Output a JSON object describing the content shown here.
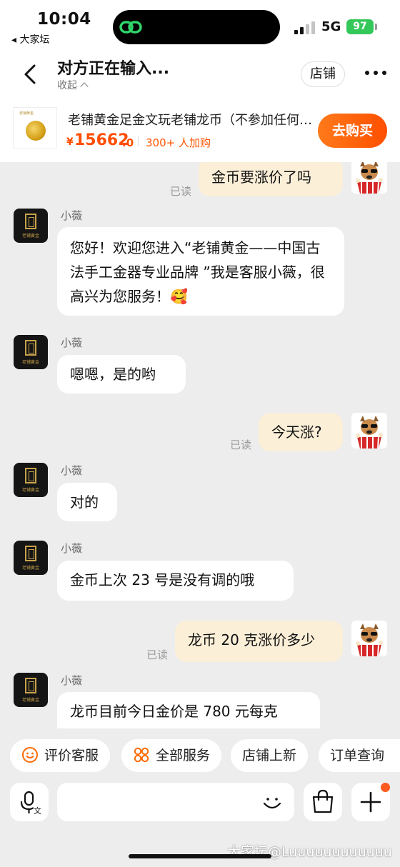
{
  "status_bar": {
    "time": "10:04",
    "back_app": "◂ 大家坛",
    "network": "5G",
    "battery": "97"
  },
  "header": {
    "title": "对方正在输入...",
    "collapse_label": "收起",
    "shop_button": "店铺"
  },
  "product": {
    "image_tag": "老铺黄金",
    "title": "老铺黄金足金文玩老铺龙币（不参加任何活动）",
    "price_symbol": "¥",
    "price_int": "15662",
    "price_dec": ".0",
    "buyers": "300+ 人加购",
    "buy_button": "去购买"
  },
  "chat": {
    "messages": [
      {
        "from": "self",
        "text": "金币要涨价了吗",
        "read": "已读"
      },
      {
        "from": "shop",
        "name": "小薇",
        "text": "您好！欢迎您进入“老铺黄金——中国古法手工金器专业品牌 ”我是客服小薇，很高兴为您服务！🥰"
      },
      {
        "from": "shop",
        "name": "小薇",
        "text": "嗯嗯，是的哟"
      },
      {
        "from": "self",
        "text": "今天涨?",
        "read": "已读"
      },
      {
        "from": "shop",
        "name": "小薇",
        "text": "对的"
      },
      {
        "from": "shop",
        "name": "小薇",
        "text": "金币上次 23 号是没有调的哦"
      },
      {
        "from": "self",
        "text": "龙币 20 克涨价多少",
        "read": "已读"
      },
      {
        "from": "shop",
        "name": "小薇",
        "text": "龙币目前今日金价是 780 元每克"
      }
    ],
    "shop_avatar_caption": "老铺黄金"
  },
  "quick_actions": [
    "评价客服",
    "全部服务",
    "店铺上新",
    "订单查询"
  ],
  "input": {
    "placeholder": ""
  },
  "watermark": "大家坛@Luuuuuuuuuuuu",
  "colors": {
    "accent": "#ff5500",
    "self_bubble": "#fcefd8",
    "background": "#ededed"
  }
}
